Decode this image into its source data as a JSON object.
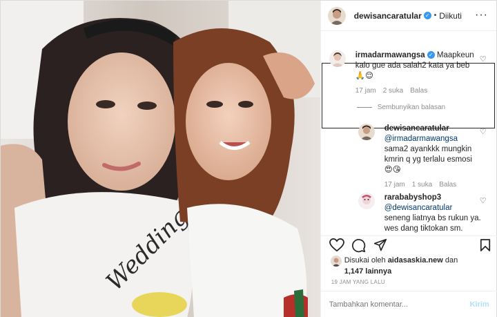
{
  "header": {
    "username": "dewisancaratular",
    "verified_mark": "✓",
    "separator": "•",
    "follow_status": "Diikuti",
    "more": "···"
  },
  "comments": [
    {
      "username": "irmadarmawangsa",
      "verified_mark": "✓",
      "text": "Maapkeun kalo gue ada salah2 kata ya beb",
      "emoji": "🙏😌",
      "time": "17 jam",
      "likes": "2 suka",
      "reply": "Balas",
      "highlighted": true
    }
  ],
  "hide_replies": "Sembunyikan balasan",
  "replies": [
    {
      "username": "dewisancaratular",
      "mention": "@irmadarmawangsa",
      "text": "sama2 ayankkk mungkin kmrin q yg terlalu esmosi",
      "emoji": "😍😘",
      "time": "17 jam",
      "likes": "1 suka",
      "reply": "Balas"
    },
    {
      "username": "rarababyshop3",
      "mention": "@dewisancaratular",
      "text": "seneng liatnya bs rukun ya. wes dang tiktokan sm."
    }
  ],
  "actions": {
    "like_icon": "heart-icon",
    "comment_icon": "comment-icon",
    "share_icon": "share-icon",
    "save_icon": "bookmark-icon"
  },
  "likes": {
    "prefix": "Disukai oleh",
    "user": "aidasaskia.new",
    "conj": "dan",
    "count": "1,147 lainnya"
  },
  "post_date": "19 JAM YANG LALU",
  "add_comment": {
    "placeholder": "Tambahkan komentar...",
    "send": "Kirim"
  },
  "colors": {
    "link": "#00376b",
    "verified": "#3897f0",
    "muted": "#8e8e8e",
    "send_disabled": "#b2dffc"
  }
}
